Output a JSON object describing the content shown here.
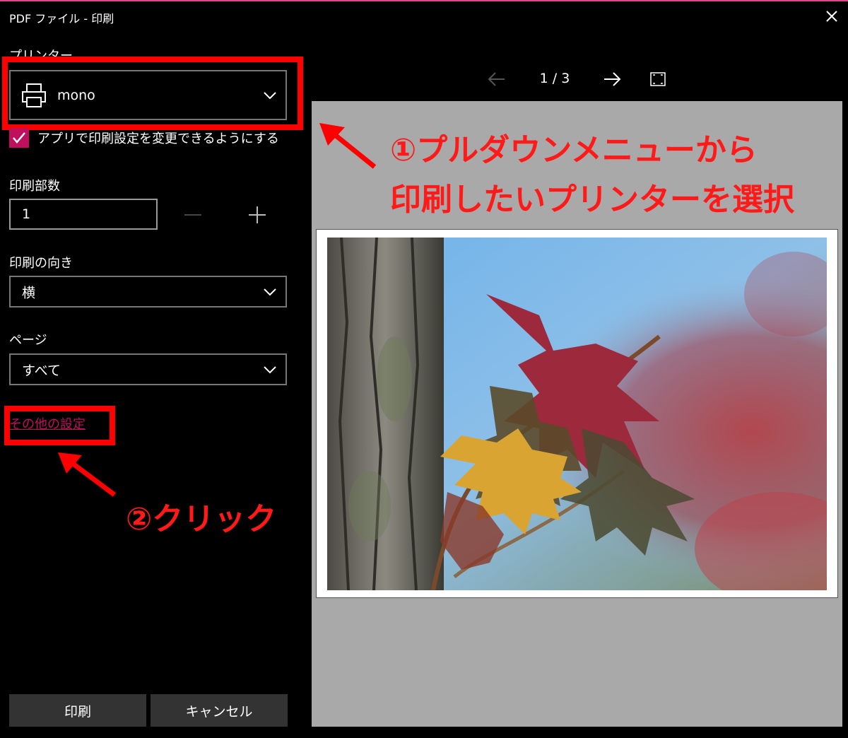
{
  "window": {
    "title": "PDF ファイル - 印刷",
    "close_icon": "close-icon"
  },
  "settings": {
    "printer": {
      "label": "プリンター",
      "value": "mono",
      "icon": "printer-icon"
    },
    "allow_app_settings": {
      "label": "アプリで印刷設定を変更できるようにする",
      "checked": true
    },
    "copies": {
      "label": "印刷部数",
      "value": "1"
    },
    "orientation": {
      "label": "印刷の向き",
      "value": "横"
    },
    "pages": {
      "label": "ページ",
      "value": "すべて"
    },
    "more_settings_link": "その他の設定"
  },
  "buttons": {
    "print": "印刷",
    "cancel": "キャンセル"
  },
  "preview": {
    "current_page": "1",
    "separator": "/",
    "total_pages": "3",
    "pager_text": "1 / 3"
  },
  "annotations": {
    "step1_line1": "①プルダウンメニューから",
    "step1_line2": "印刷したいプリンターを選択",
    "step2": "②クリック"
  },
  "colors": {
    "accent": "#bf0f5d",
    "annotation_red": "#ff0000",
    "preview_bg": "#a9a9a9",
    "button_bg": "#333333"
  }
}
